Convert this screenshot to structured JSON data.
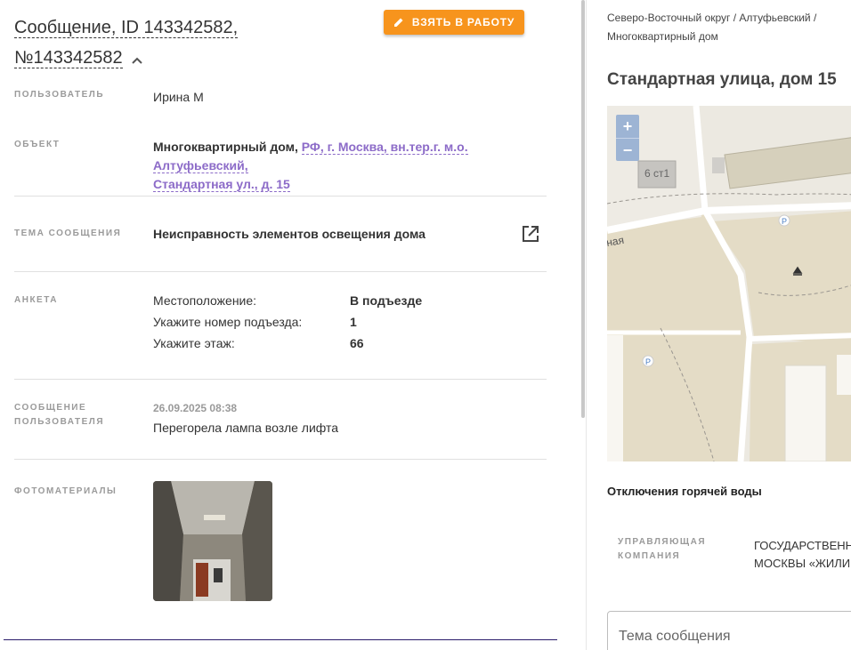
{
  "header": {
    "title_line1": "Сообщение, ID 143342582,",
    "title_line2": "№143342582",
    "take_button": "ВЗЯТЬ В РАБОТУ"
  },
  "fields": {
    "user_label": "ПОЛЬЗОВАТЕЛЬ",
    "user_value": "Ирина М",
    "object_label": "ОБЪЕКТ",
    "object_type": "Многоквартирный дом,",
    "object_addr_line1": "РФ, г. Москва, вн.тер.г. м.о. Алтуфьевский,",
    "object_addr_line2": "Стандартная ул., д. 15",
    "topic_label": "ТЕМА СООБЩЕНИЯ",
    "topic_value": "Неисправность элементов освещения дома",
    "survey_label": "АНКЕТА",
    "survey": [
      {
        "q": "Местоположение:",
        "a": "В подъезде"
      },
      {
        "q": "Укажите номер подъезда:",
        "a": "1"
      },
      {
        "q": "Укажите этаж:",
        "a": "66"
      }
    ],
    "message_label_line1": "СООБЩЕНИЕ",
    "message_label_line2": "ПОЛЬЗОВАТЕЛЯ",
    "message_date": "26.09.2025 08:38",
    "message_text": "Перегорела лампа возле лифта",
    "photos_label": "ФОТОМАТЕРИАЛЫ"
  },
  "right": {
    "breadcrumb_line1": "Северо-Восточный округ / Алтуфьевский /",
    "breadcrumb_line2": "Многоквартирный дом",
    "address": "Стандартная улица, дом 15",
    "map": {
      "zoom_in": "+",
      "zoom_out": "−",
      "building_label": "6 ст1",
      "street_label": "ная",
      "parking": "P"
    },
    "hot_water": "Отключения горячей воды",
    "mc_label_line1": "УПРАВЛЯЮЩАЯ",
    "mc_label_line2": "КОМПАНИЯ",
    "mc_value_line1": "ГОСУДАРСТВЕНН",
    "mc_value_line2": "МОСКВЫ «ЖИЛИ",
    "subject_placeholder": "Тема сообщения"
  },
  "colors": {
    "accent_orange": "#f7941d",
    "link_purple": "#8c6bc8",
    "label_gray": "#9a9a9a"
  }
}
